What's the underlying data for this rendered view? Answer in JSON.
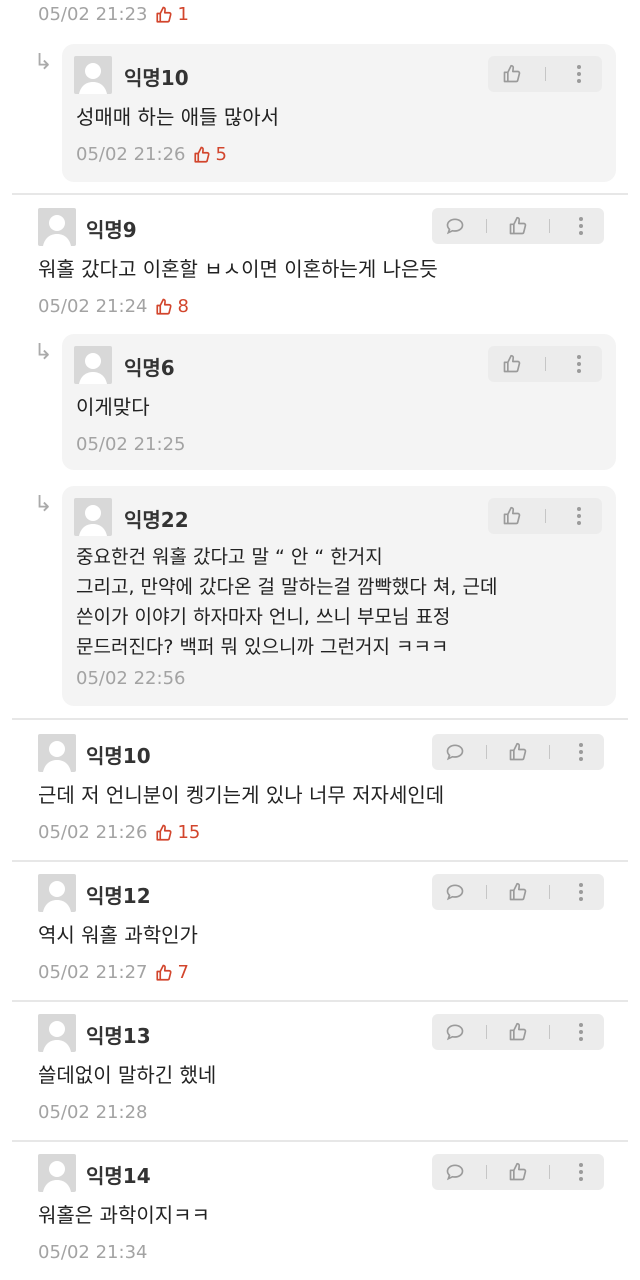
{
  "comments": [
    {
      "time": "05/02 21:23",
      "likes": "1"
    },
    {
      "name": "익명10",
      "text": "성매매 하는 애들 많아서",
      "time": "05/02 21:26",
      "likes": "5"
    },
    {
      "name": "익명9",
      "text": "워홀 갔다고 이혼할 ㅂㅅ이면 이혼하는게 나은듯",
      "time": "05/02 21:24",
      "likes": "8"
    },
    {
      "name": "익명6",
      "text": "이게맞다",
      "time": "05/02 21:25"
    },
    {
      "name": "익명22",
      "lines": [
        "중요한건 워홀 갔다고 말 “ 안 “ 한거지",
        "그리고, 만약에 갔다온 걸 말하는걸 깜빡했다 쳐, 근데",
        "쓴이가 이야기 하자마자 언니, 쓰니 부모님 표정",
        "문드러진다? 백퍼 뭐 있으니까 그런거지 ㅋㅋㅋ"
      ],
      "time": "05/02 22:56"
    },
    {
      "name": "익명10",
      "text": "근데 저 언니분이 켕기는게 있나 너무 저자세인데",
      "time": "05/02 21:26",
      "likes": "15"
    },
    {
      "name": "익명12",
      "text": "역시 워홀 과학인가",
      "time": "05/02 21:27",
      "likes": "7"
    },
    {
      "name": "익명13",
      "text": "쓸데없이 말하긴 했네",
      "time": "05/02 21:28"
    },
    {
      "name": "익명14",
      "text": "워홀은 과학이지ㅋㅋ",
      "time": "05/02 21:34"
    }
  ],
  "icons": {
    "like": "thumbs-up-icon",
    "reply": "speech-bubble-icon",
    "more": "vertical-dots-icon",
    "reply_arrow": "reply-arrow-icon",
    "avatar": "default-avatar-icon"
  },
  "colors": {
    "like_accent": "#d2452c",
    "reply_bg": "#f4f4f4",
    "meta_gray": "#a3a3a3"
  }
}
